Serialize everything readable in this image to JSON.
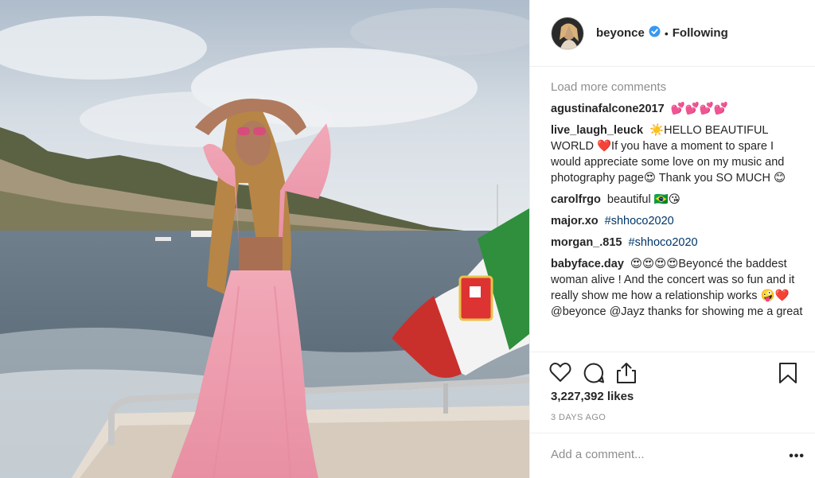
{
  "post": {
    "username": "beyonce",
    "separator": "•",
    "follow_status": "Following",
    "load_more": "Load more comments",
    "comments": [
      {
        "user": "agustinafalcone2017",
        "text": "💕💕💕💕"
      },
      {
        "user": "live_laugh_leuck",
        "text": "☀️HELLO BEAUTIFUL WORLD ❤️If you have a moment to spare I would appreciate some love on my music and photography page😍 Thank you SO MUCH 😊"
      },
      {
        "user": "carolfrgo",
        "text": "beautiful 🇧🇷😘"
      },
      {
        "user": "major.xo",
        "text": "#shhoco2020"
      },
      {
        "user": "morgan_.815",
        "text": "#shhoco2020"
      },
      {
        "user": "babyface.day",
        "text": "😍😍😍😍Beyoncé the baddest woman alive ! And the concert was so fun and it really show me how a relationship works 🤪❤️ @beyonce @Jayz thanks for showing me a great"
      }
    ],
    "likes": "3,227,392 likes",
    "time": "3 DAYS AGO",
    "comment_placeholder": "Add a comment...",
    "more_label": "•••"
  },
  "icons": {
    "like": "heart-icon",
    "comment": "comment-icon",
    "share": "share-icon",
    "save": "bookmark-icon",
    "verified": "verified-badge-icon"
  },
  "colors": {
    "verified": "#3897f0",
    "muted": "#8e8e8e",
    "text": "#262626"
  }
}
